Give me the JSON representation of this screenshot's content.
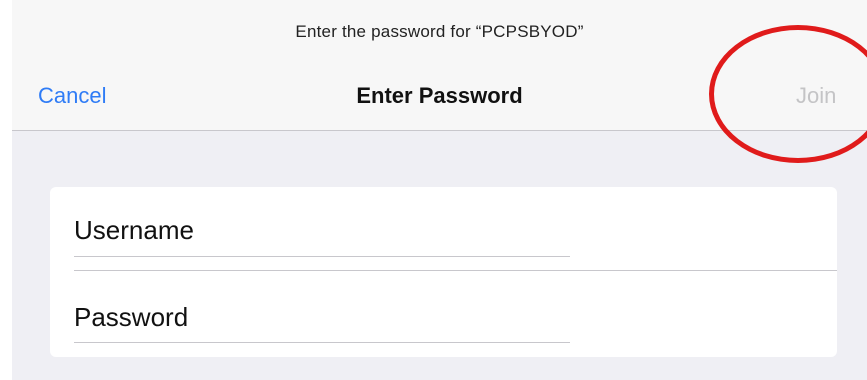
{
  "dialog": {
    "prompt": "Enter the password for “PCPSBYOD”",
    "title": "Enter Password",
    "cancel_label": "Cancel",
    "join_label": "Join",
    "join_enabled": false
  },
  "form": {
    "username": {
      "placeholder": "Username",
      "value": ""
    },
    "password": {
      "placeholder": "Password",
      "value": ""
    }
  },
  "annotation": {
    "shape": "circle",
    "color": "#e01b1b",
    "target": "Join"
  },
  "colors": {
    "accent": "#2f7cf6",
    "disabled": "#c4c4c6",
    "background": "#efeff4",
    "navbar": "#f7f7f7"
  }
}
